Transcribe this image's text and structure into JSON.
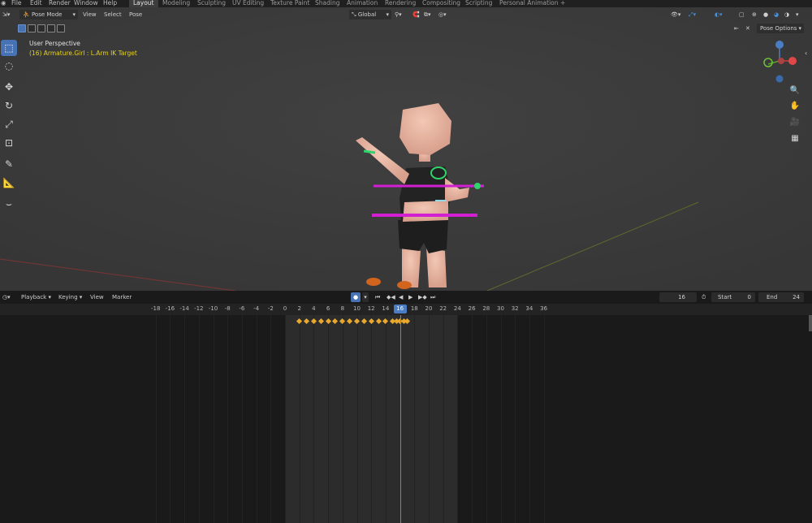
{
  "menu": {
    "items": [
      "File",
      "Edit",
      "Render",
      "Window",
      "Help"
    ],
    "workspaces": [
      "Layout",
      "Modeling",
      "Sculpting",
      "UV Editing",
      "Texture Paint",
      "Shading",
      "Animation",
      "Rendering",
      "Compositing",
      "Scripting",
      "Personal Animation"
    ],
    "active_workspace": "Layout",
    "add_tab": "+"
  },
  "viewport": {
    "mode": "Pose Mode",
    "menus": [
      "View",
      "Select",
      "Pose"
    ],
    "transform_orientation": "Global",
    "pose_options": "Pose Options",
    "perspective_label": "User Perspective",
    "object_label": "(16) Armature.Girl : L.Arm IK Target",
    "gizmo_axes": {
      "z": "Z",
      "y": "Y",
      "x": "X"
    },
    "tools": [
      "select-box",
      "cursor",
      "move",
      "rotate",
      "scale",
      "transform",
      "annotate",
      "measure",
      "relax"
    ]
  },
  "timeline": {
    "menus": [
      "Playback",
      "Keying",
      "View",
      "Marker"
    ],
    "current_frame": "16",
    "start_label": "Start",
    "start_value": "0",
    "end_label": "End",
    "end_value": "24",
    "ruler_ticks": [
      "-18",
      "-16",
      "-14",
      "-12",
      "-10",
      "-8",
      "-6",
      "-4",
      "-2",
      "0",
      "2",
      "4",
      "6",
      "8",
      "10",
      "12",
      "14",
      "16",
      "18",
      "20",
      "22",
      "24",
      "26",
      "28",
      "30",
      "32",
      "34",
      "36"
    ],
    "keyframes": [
      2,
      3,
      4,
      5,
      6,
      7,
      8,
      9,
      10,
      11,
      12,
      13,
      14,
      15,
      15.5,
      16,
      16.5,
      17
    ]
  },
  "colors": {
    "accent": "#4772b3",
    "keyframe": "#e8a82e",
    "playhead": "#4a90d9",
    "object_label": "#e6d21f",
    "bone_magenta": "#d21fd2",
    "bone_green": "#2fd46a"
  }
}
